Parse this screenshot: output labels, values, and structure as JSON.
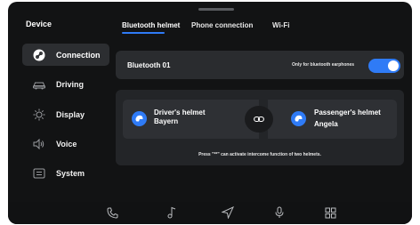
{
  "sidebar": {
    "title": "Device",
    "items": [
      {
        "label": "Connection",
        "icon": "link-circle-icon",
        "active": true
      },
      {
        "label": "Driving",
        "icon": "car-icon",
        "active": false
      },
      {
        "label": "Display",
        "icon": "sun-icon",
        "active": false
      },
      {
        "label": "Voice",
        "icon": "speaker-icon",
        "active": false
      },
      {
        "label": "System",
        "icon": "settings-panel-icon",
        "active": false
      }
    ]
  },
  "tabs": [
    {
      "label": "Bluetooth helmet",
      "active": true
    },
    {
      "label": "Phone connection",
      "active": false
    },
    {
      "label": "Wi-Fi",
      "active": false
    }
  ],
  "bluetooth": {
    "name": "Bluetooth 01",
    "note": "Only for bluetooth earphones",
    "toggle_on": true
  },
  "helmets": {
    "driver": {
      "title": "Driver's helmet",
      "name": "Bayern"
    },
    "passenger": {
      "title": "Passenger's helmet",
      "name": "Angela"
    },
    "hint": "Press \"**\" can activate intercome function of two helmets."
  },
  "bottom_nav": [
    "phone-icon",
    "music-icon",
    "navigation-icon",
    "microphone-icon",
    "apps-grid-icon"
  ],
  "colors": {
    "accent": "#2f7bf6",
    "background": "#121314",
    "card": "#2a2c2f"
  }
}
